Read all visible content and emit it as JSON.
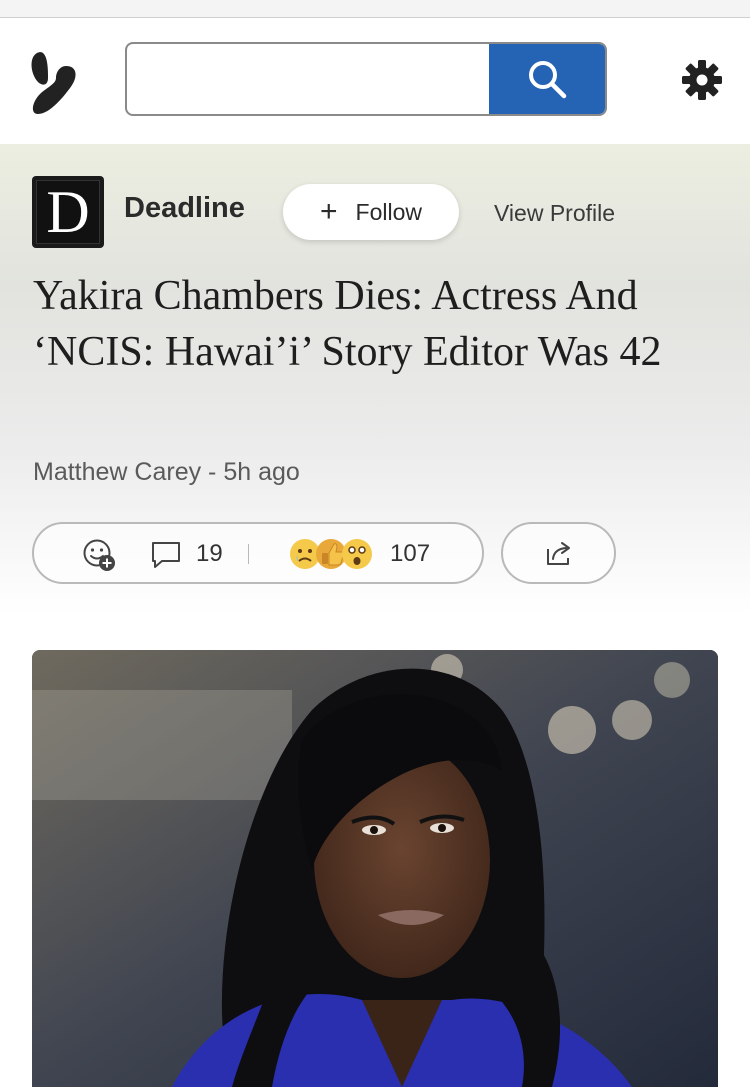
{
  "header": {
    "logo_icon": "butterfly-logo-icon",
    "search": {
      "placeholder": "",
      "button_icon": "search-icon"
    },
    "settings_icon": "gear-icon"
  },
  "publisher": {
    "logo_letter": "D",
    "name": "Deadline",
    "follow_label": "Follow",
    "view_profile_label": "View Profile"
  },
  "article": {
    "title": "Yakira Chambers Dies: Actress And ‘NCIS: Hawai’i’ Story Editor Was 42",
    "byline": "Matthew Carey - 5h ago",
    "comment_count": "19",
    "reaction_count": "107",
    "reaction_emojis": [
      "sad-face-icon",
      "thumbs-up-icon",
      "surprised-face-icon"
    ]
  },
  "colors": {
    "accent": "#2563b5",
    "text_dark": "#1e1e1e",
    "text_muted": "#5a5a5a"
  }
}
